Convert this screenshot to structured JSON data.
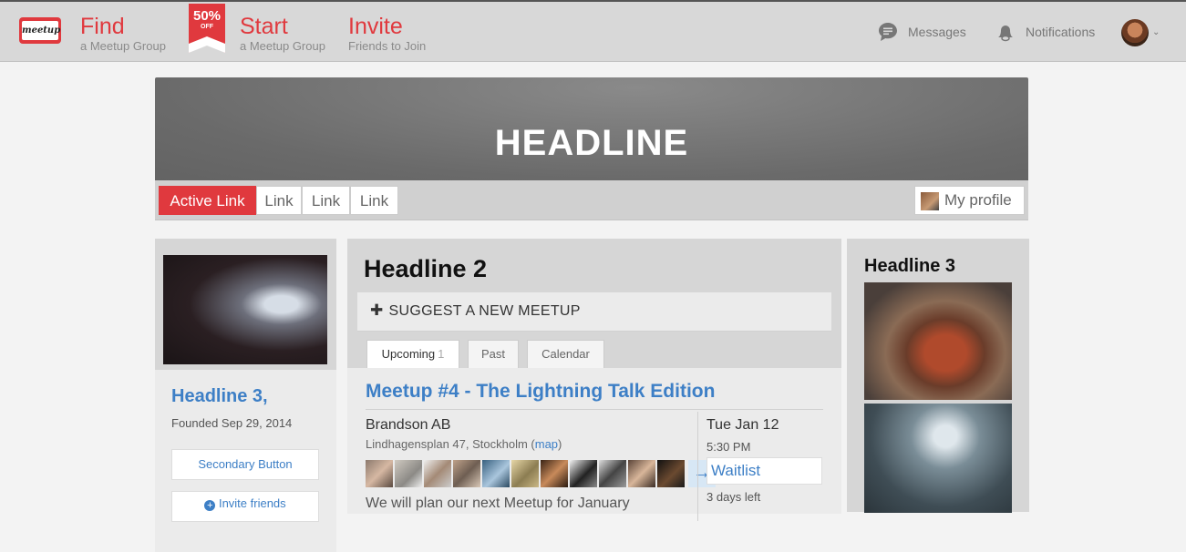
{
  "topbar": {
    "logo_text": "meetup",
    "find_title": "Find",
    "find_sub": "a Meetup Group",
    "promo_percent": "50%",
    "promo_off": "OFF",
    "start_title": "Start",
    "start_sub": "a Meetup Group",
    "invite_title": "Invite",
    "invite_sub": "Friends to Join",
    "messages_label": "Messages",
    "notifications_label": "Notifications",
    "accent_color": "#e0393e"
  },
  "hero": {
    "headline": "HEADLINE"
  },
  "tabs": {
    "active_label": "Active Link",
    "links": [
      "Link",
      "Link",
      "Link"
    ],
    "profile_label": "My profile"
  },
  "left": {
    "group_title": "Headline 3,",
    "founded": "Founded Sep 29, 2014",
    "secondary_button": "Secondary Button",
    "invite_button": "Invite friends"
  },
  "main": {
    "title": "Headline 2",
    "suggest_label": "SUGGEST A NEW MEETUP",
    "tab_upcoming": "Upcoming",
    "tab_upcoming_count": "1",
    "tab_past": "Past",
    "tab_calendar": "Calendar",
    "event": {
      "title": "Meetup #4 - The Lightning Talk Edition",
      "venue": "Brandson AB",
      "address": "Lindhagensplan 47, Stockholm (",
      "map_link": "map",
      "address_end": ")",
      "description": "We will plan our next Meetup for January",
      "date": "Tue Jan 12",
      "time": "5:30 PM",
      "rsvp_button": "Waitlist",
      "days_left": "3 days left",
      "more_arrow": "→"
    }
  },
  "right": {
    "title": "Headline 3"
  }
}
